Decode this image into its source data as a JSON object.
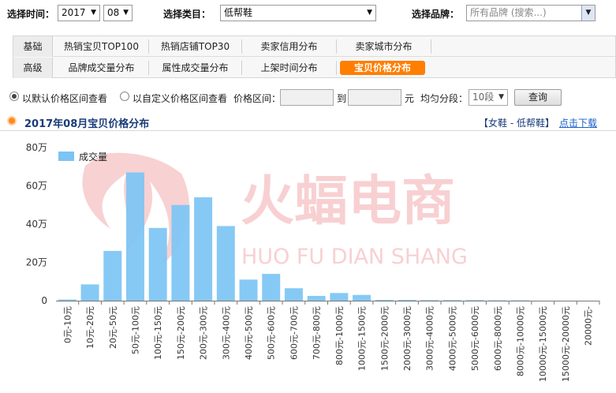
{
  "filters": {
    "time_label": "选择时间：",
    "year": "2017",
    "month": "08",
    "category_label": "选择类目：",
    "category": "低帮鞋",
    "brand_label": "选择品牌：",
    "brand_placeholder": "所有品牌 (搜索...)"
  },
  "tabs": {
    "row1_label": "基础",
    "row1": [
      "热销宝贝TOP100",
      "热销店铺TOP30",
      "卖家信用分布",
      "卖家城市分布"
    ],
    "row2_label": "高级",
    "row2": [
      "品牌成交量分布",
      "属性成交量分布",
      "上架时间分布",
      "宝贝价格分布"
    ],
    "active": "宝贝价格分布"
  },
  "options": {
    "default_range": "以默认价格区间查看",
    "custom_range": "以自定义价格区间查看",
    "price_range_label": "价格区间：",
    "to": "到",
    "unit": "元",
    "segment_label": "均匀分段：",
    "segment_value": "10段",
    "query_button": "查询"
  },
  "header": {
    "title": "2017年08月宝贝价格分布",
    "crumb": "【女鞋 - 低帮鞋】",
    "download": "点击下载"
  },
  "watermark": {
    "title": "火蝠电商",
    "subtitle": "HUO FU DIAN SHANG"
  },
  "colors": {
    "bar": "#7cc4f4",
    "accent": "#ff7e00",
    "watermark": "#f2a3a6"
  },
  "chart_data": {
    "type": "bar",
    "categories": [
      "0元-10元",
      "10元-20元",
      "20元-50元",
      "50元-100元",
      "100元-150元",
      "150元-200元",
      "200元-300元",
      "300元-400元",
      "400元-500元",
      "500元-600元",
      "600元-700元",
      "700元-800元",
      "800元-1000元",
      "1000元-1500元",
      "1500元-2000元",
      "2000元-3000元",
      "3000元-4000元",
      "4000元-5000元",
      "5000元-6000元",
      "6000元-8000元",
      "8000元-10000元",
      "10000元-15000元",
      "15000元-20000元",
      "20000元-"
    ],
    "series": [
      {
        "name": "成交量",
        "values": [
          0.6,
          8.5,
          26,
          67,
          38,
          50,
          54,
          39,
          11,
          14,
          6.5,
          2.5,
          4,
          3,
          0.4,
          0.4,
          0.3,
          0.3,
          0.3,
          0.2,
          0.2,
          0,
          0,
          0
        ]
      }
    ],
    "yticks": [
      "0",
      "20万",
      "40万",
      "60万",
      "80万"
    ],
    "ylim": [
      0,
      80
    ],
    "unit": "万",
    "legend": "top-left",
    "grid": false
  }
}
